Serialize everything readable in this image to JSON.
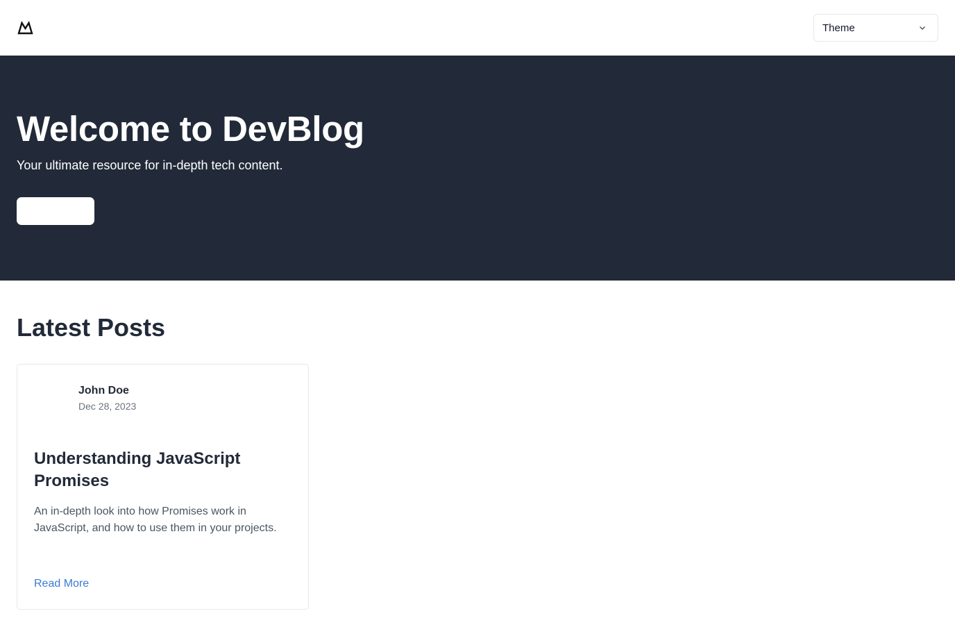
{
  "header": {
    "logo_icon": "mountain-logo-icon",
    "theme_select": {
      "selected": "Theme",
      "icon": "chevron-down-icon"
    }
  },
  "hero": {
    "title": "Welcome to DevBlog",
    "subtitle": "Your ultimate resource for in-depth tech content.",
    "button_label": "",
    "background": "#222a39"
  },
  "latest": {
    "heading": "Latest Posts",
    "posts": [
      {
        "author": "John Doe",
        "date": "Dec 28, 2023",
        "title": "Understanding JavaScript Promises",
        "excerpt": "An in-depth look into how Promises work in JavaScript, and how to use them in your projects.",
        "link_label": "Read More"
      }
    ]
  },
  "colors": {
    "link": "#3b7bd4",
    "heading": "#222a39",
    "muted": "#6b7280"
  }
}
